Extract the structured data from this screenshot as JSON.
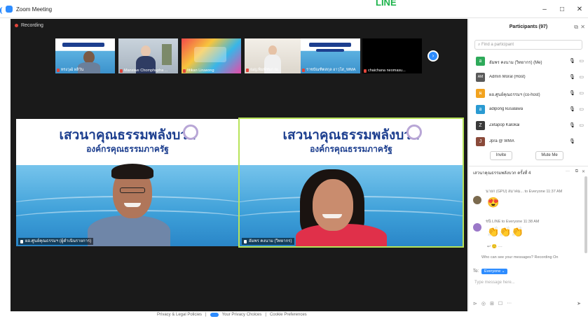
{
  "window": {
    "title": "Zoom Meeting",
    "background_logo": "LINE",
    "minimize_label": "–",
    "maximize_label": "□",
    "close_label": "✕"
  },
  "meeting": {
    "recording_label": "Recording",
    "thumbnails": [
      {
        "name": "ทรงวุฒิ ผลิวัน"
      },
      {
        "name": "Mansiwe Chomphupha ..."
      },
      {
        "name": "Ittikan Liruwong"
      },
      {
        "name": "ณญ.พิมพ์ชนก ณ..."
      },
      {
        "name": "ราชบัณฑิตสกุล อาวุโส_WMA"
      },
      {
        "name": "chaichana neomasu..."
      }
    ],
    "main_tiles": [
      {
        "banner_title": "เสวนาคุณธรรมพลังบวก",
        "banner_subtitle": "องค์กรคุณธรรมภาครัฐ",
        "caption": "ผอ.ศูนย์คุณธรรมฯ (ผู้ดำเนินรายการ)"
      },
      {
        "banner_title": "เสวนาคุณธรรมพลังบวก",
        "banner_subtitle": "องค์กรคุณธรรมภาครัฐ",
        "caption": "อัมพร คงนาม (วิทยากร)"
      }
    ],
    "next_icon": "›"
  },
  "footer": {
    "privacy_label": "Privacy & Legal Policies",
    "your_privacy_label": "Your Privacy Choices",
    "cookie_label": "Cookie Preferences",
    "divider": "|"
  },
  "participants": {
    "title": "Participants (97)",
    "search_placeholder": "Find a participant",
    "items": [
      {
        "initial": "อ",
        "name": "อัมพร คงนาม (วิทยากร) (Me)",
        "color": "#2eaa5a",
        "mic": "🎙",
        "cam": "▭"
      },
      {
        "initial": "AM",
        "name": "Admin Moral (Host)",
        "color": "#5a5a5a",
        "mic": "🎙",
        "cam": "▭"
      },
      {
        "initial": "ผ",
        "name": "ผอ.ศูนย์คุณธรรมฯ (co-host)",
        "color": "#f2a31f",
        "mic": "🎙",
        "cam": "▭"
      },
      {
        "initial": "อ",
        "name": "adipong kusalawa",
        "color": "#2a9ad2",
        "mic": "🎙",
        "cam": "▭"
      },
      {
        "initial": "Z",
        "name": "Zetapop Kalokai",
        "color": "#3a3a3a",
        "mic": "🎙",
        "cam": "▭"
      },
      {
        "initial": "J",
        "name": "Jpra @ WMA",
        "color": "#8a4a3a",
        "mic": "🎙",
        "cam": ""
      }
    ],
    "invite_label": "Invite",
    "mute_all_label": "Mute Me"
  },
  "chat": {
    "header": "เสวนาคุณธรรมพลังบวก ครั้งที่ 4",
    "more_icon": "···",
    "popout_icon": "⧉",
    "close_icon": "✕",
    "messages": [
      {
        "meta": "นายก (GPU) สมาคม... to Everyone 11:37 AM",
        "emoji": "😍"
      },
      {
        "meta": "ชนิ LINE to Everyone 11:38 AM",
        "emoji": "👏👏👏"
      }
    ],
    "reaction_row": "↩ 🙂 ···",
    "who_can_see": "Who can see your messages? Recording On",
    "to_label": "To:",
    "to_value": "Everyone ⌄",
    "input_placeholder": "Type message here...",
    "tools": [
      "⊳",
      "◎",
      "⊞",
      "☐",
      "···"
    ],
    "send_icon": "➤"
  }
}
